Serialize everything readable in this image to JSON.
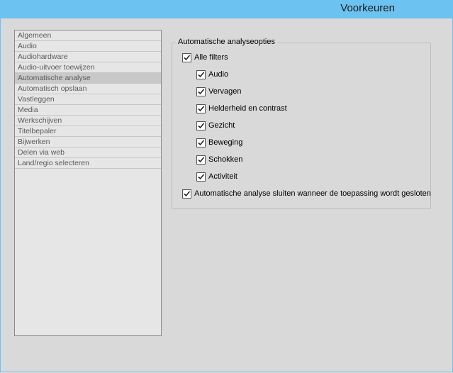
{
  "window": {
    "title": "Voorkeuren"
  },
  "categories": [
    {
      "label": "Algemeen",
      "selected": false
    },
    {
      "label": "Audio",
      "selected": false
    },
    {
      "label": "Audiohardware",
      "selected": false
    },
    {
      "label": "Audio-uitvoer toewijzen",
      "selected": false
    },
    {
      "label": "Automatische analyse",
      "selected": true
    },
    {
      "label": "Automatisch opslaan",
      "selected": false
    },
    {
      "label": "Vastleggen",
      "selected": false
    },
    {
      "label": "Media",
      "selected": false
    },
    {
      "label": "Werkschijven",
      "selected": false
    },
    {
      "label": "Titelbepaler",
      "selected": false
    },
    {
      "label": "Bijwerken",
      "selected": false
    },
    {
      "label": "Delen via web",
      "selected": false
    },
    {
      "label": "Land/regio selecteren",
      "selected": false
    }
  ],
  "analysis": {
    "group_title": "Automatische analyseopties",
    "all_filters": {
      "label": "Alle filters",
      "checked": true
    },
    "filters": [
      {
        "label": "Audio",
        "checked": true
      },
      {
        "label": "Vervagen",
        "checked": true
      },
      {
        "label": "Helderheid en contrast",
        "checked": true
      },
      {
        "label": "Gezicht",
        "checked": true
      },
      {
        "label": "Beweging",
        "checked": true
      },
      {
        "label": "Schokken",
        "checked": true
      },
      {
        "label": "Activiteit",
        "checked": true
      }
    ],
    "close_on_exit": {
      "label": "Automatische analyse sluiten wanneer de toepassing wordt gesloten",
      "checked": true
    }
  },
  "colors": {
    "titlebar": "#6cc2f0",
    "background": "#d9d9d9",
    "list_bg": "#e6e6e6",
    "selected": "#c8c8c8"
  },
  "icons": {
    "checkbox": "checkmark-icon"
  }
}
